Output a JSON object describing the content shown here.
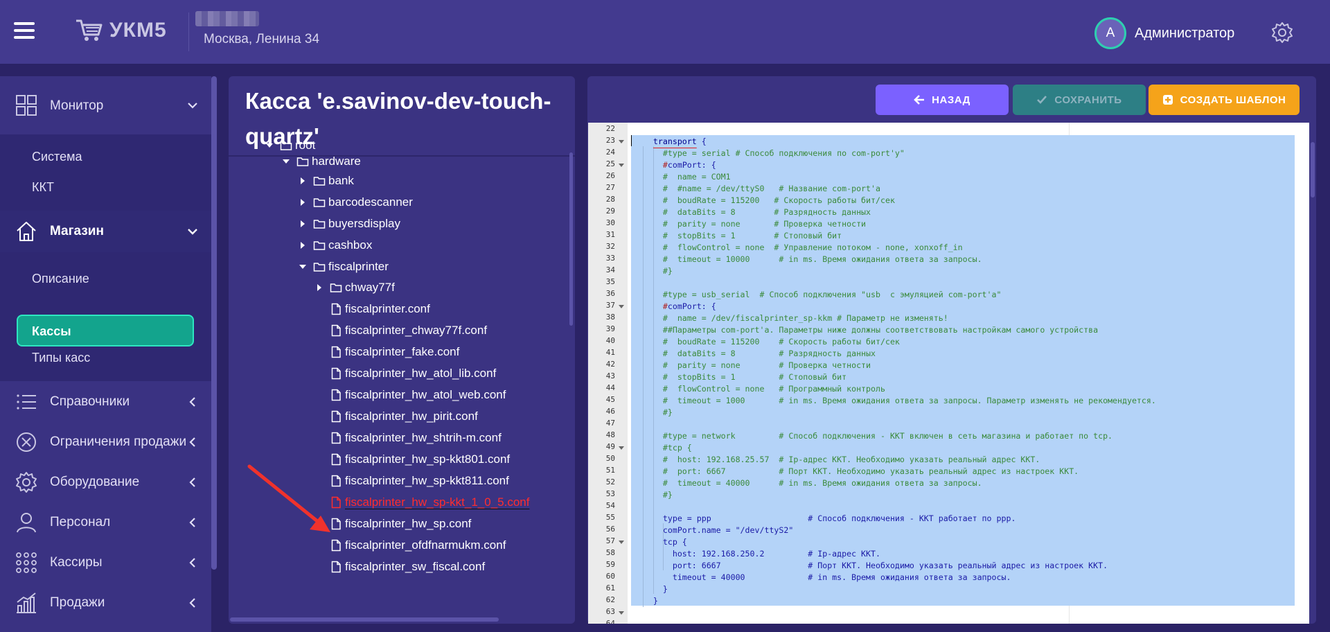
{
  "header": {
    "logo_text": "УКМ5",
    "store_address": "Москва, Ленина 34",
    "avatar_initial": "А",
    "user_name": "Администратор"
  },
  "sidebar": {
    "monitor": "Монитор",
    "monitor_sub": [
      "Система",
      "ККТ"
    ],
    "magazin": "Магазин",
    "magazin_sub": [
      "Описание",
      "Кассы",
      "Типы касс"
    ],
    "spravochniki": "Справочники",
    "ogranicheniya": "Ограничения продажи",
    "oborudovanie": "Оборудование",
    "personal": "Персонал",
    "kassiry": "Кассиры",
    "prodazhi": "Продажи"
  },
  "tree": {
    "title": "Касса 'e.savinov-dev-touch-quartz'",
    "items": [
      {
        "label": "root",
        "type": "folder",
        "toggle": "open"
      },
      {
        "label": "hardware",
        "type": "folder",
        "toggle": "open"
      },
      {
        "label": "bank",
        "type": "folder",
        "toggle": "closed"
      },
      {
        "label": "barcodescanner",
        "type": "folder",
        "toggle": "closed"
      },
      {
        "label": "buyersdisplay",
        "type": "folder",
        "toggle": "closed"
      },
      {
        "label": "cashbox",
        "type": "folder",
        "toggle": "closed"
      },
      {
        "label": "fiscalprinter",
        "type": "folder",
        "toggle": "open"
      },
      {
        "label": "chway77f",
        "type": "folder",
        "toggle": "closed"
      },
      {
        "label": "fiscalprinter.conf",
        "type": "file"
      },
      {
        "label": "fiscalprinter_chway77f.conf",
        "type": "file"
      },
      {
        "label": "fiscalprinter_fake.conf",
        "type": "file"
      },
      {
        "label": "fiscalprinter_hw_atol_lib.conf",
        "type": "file"
      },
      {
        "label": "fiscalprinter_hw_atol_web.conf",
        "type": "file"
      },
      {
        "label": "fiscalprinter_hw_pirit.conf",
        "type": "file"
      },
      {
        "label": "fiscalprinter_hw_shtrih-m.conf",
        "type": "file"
      },
      {
        "label": "fiscalprinter_hw_sp-kkt801.conf",
        "type": "file"
      },
      {
        "label": "fiscalprinter_hw_sp-kkt811.conf",
        "type": "file"
      },
      {
        "label": "fiscalprinter_hw_sp-kkt_1_0_5.conf",
        "type": "file",
        "selected": true
      },
      {
        "label": "fiscalprinter_hw_sp.conf",
        "type": "file"
      },
      {
        "label": "fiscalprinter_ofdfnarmukm.conf",
        "type": "file"
      },
      {
        "label": "fiscalprinter_sw_fiscal.conf",
        "type": "file"
      }
    ]
  },
  "toolbar": {
    "back_label": "НАЗАД",
    "save_label": "СОХРАНИТЬ",
    "template_label": "СОЗДАТЬ ШАБЛОН"
  },
  "editor": {
    "first_line": 22,
    "fold_lines": [
      23,
      25,
      37,
      49,
      57,
      63
    ],
    "lines": [
      {
        "t": "",
        "c": "cm"
      },
      {
        "t": "    transport {",
        "c": "fn"
      },
      {
        "t": "      #type = serial # Способ подключения по com-port'y\"",
        "c": "cm"
      },
      {
        "t": "      #comPort: {",
        "c": "kw"
      },
      {
        "t": "      #  name = COM1",
        "c": "cm"
      },
      {
        "t": "      #  #name = /dev/ttyS0   # Название com-port'a",
        "c": "cm"
      },
      {
        "t": "      #  boudRate = 115200   # Скорость работы бит/сек",
        "c": "cm"
      },
      {
        "t": "      #  dataBits = 8        # Разрядность данных",
        "c": "cm"
      },
      {
        "t": "      #  parity = none       # Проверка четности",
        "c": "cm"
      },
      {
        "t": "      #  stopBits = 1        # Стоповый бит",
        "c": "cm"
      },
      {
        "t": "      #  flowControl = none  # Управление потоком - none, xonxoff_in",
        "c": "cm"
      },
      {
        "t": "      #  timeout = 10000      # in ms. Время ожидания ответа за запросы.",
        "c": "cm"
      },
      {
        "t": "      #}",
        "c": "cm"
      },
      {
        "t": "",
        "c": "cm"
      },
      {
        "t": "      #type = usb_serial  # Способ подключения \"usb  с эмуляцией com-port'a\"",
        "c": "cm"
      },
      {
        "t": "      #comPort: {",
        "c": "kw"
      },
      {
        "t": "      #  name = /dev/fiscalprinter_sp-kkm # Параметр не изменять!",
        "c": "cm"
      },
      {
        "t": "      ##Параметры com-port'a. Параметры ниже должны соответствовать настройкам самого устройства",
        "c": "cm"
      },
      {
        "t": "      #  boudRate = 115200    # Скорость работы бит/сек",
        "c": "cm"
      },
      {
        "t": "      #  dataBits = 8         # Разрядность данных",
        "c": "cm"
      },
      {
        "t": "      #  parity = none        # Проверка четности",
        "c": "cm"
      },
      {
        "t": "      #  stopBits = 1         # Стоповый бит",
        "c": "cm"
      },
      {
        "t": "      #  flowControl = none   # Программный контроль",
        "c": "cm"
      },
      {
        "t": "      #  timeout = 1000       # in ms. Время ожидания ответа за запросы. Параметр изменять не рекомендуется.",
        "c": "cm"
      },
      {
        "t": "      #}",
        "c": "cm"
      },
      {
        "t": "",
        "c": "cm"
      },
      {
        "t": "      #type = network         # Способ подключения - ККТ включен в сеть магазина и работает по tcp.",
        "c": "cm"
      },
      {
        "t": "      #tcp {",
        "c": "cm"
      },
      {
        "t": "      #  host: 192.168.25.57  # Ip-адрес ККТ. Необходимо указать реальный адрес ККТ.",
        "c": "cm"
      },
      {
        "t": "      #  port: 6667           # Порт ККТ. Необходимо указать реальный адрес из настроек ККТ.",
        "c": "cm"
      },
      {
        "t": "      #  timeout = 40000      # in ms. Время ожидания ответа за запросы.",
        "c": "cm"
      },
      {
        "t": "      #}",
        "c": "cm"
      },
      {
        "t": "",
        "c": "cm"
      },
      {
        "t": "      type = ppp                    # Способ подключения - ККТ работает по ppp.",
        "c": "mix"
      },
      {
        "t": "      comPort.name = \"/dev/ttyS2\"",
        "c": "kw"
      },
      {
        "t": "      tcp {",
        "c": "kw"
      },
      {
        "t": "        host: 192.168.250.2         # Ip-адрес ККТ.",
        "c": "mix"
      },
      {
        "t": "        port: 6667                  # Порт ККТ. Необходимо указать реальный адрес из настроек ККТ.",
        "c": "mix"
      },
      {
        "t": "        timeout = 40000             # in ms. Время ожидания ответа за запросы.",
        "c": "mix"
      },
      {
        "t": "      }",
        "c": "kw"
      },
      {
        "t": "    }",
        "c": "kw"
      },
      {
        "t": "",
        "c": "cm"
      },
      {
        "t": "",
        "c": "cm"
      }
    ]
  }
}
